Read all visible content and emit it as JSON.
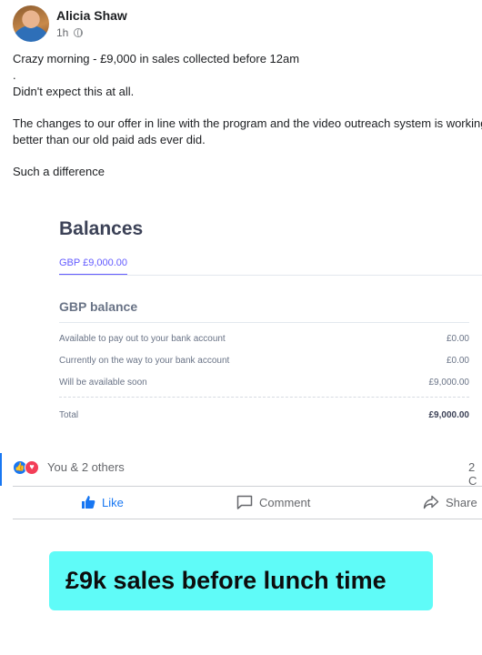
{
  "post": {
    "author": "Alicia Shaw",
    "time": "1h",
    "lines": [
      "Crazy morning - £9,000 in sales collected before 12am",
      ".",
      "Didn't expect this at all.",
      "The changes to our offer in line with the program and the video outreach system is working",
      "better than our old paid ads ever did.",
      "Such a difference"
    ]
  },
  "balances": {
    "title": "Balances",
    "tab": "GBP  £9,000.00",
    "subtitle": "GBP balance",
    "rows": [
      {
        "label": "Available to pay out to your bank account",
        "value": "£0.00"
      },
      {
        "label": "Currently on the way to your bank account",
        "value": "£0.00"
      },
      {
        "label": "Will be available soon",
        "value": "£9,000.00"
      }
    ],
    "total_label": "Total",
    "total_value": "£9,000.00"
  },
  "reactions": {
    "summary": "You & 2 others",
    "count": "2 C"
  },
  "actions": {
    "like": "Like",
    "comment": "Comment",
    "share": "Share"
  },
  "banner": {
    "text": "£9k sales before lunch time",
    "color": "#5ffbf8"
  },
  "icons": [
    "globe-icon",
    "like-reaction-icon",
    "love-reaction-icon",
    "thumbs-up-icon",
    "comment-icon",
    "share-icon"
  ]
}
